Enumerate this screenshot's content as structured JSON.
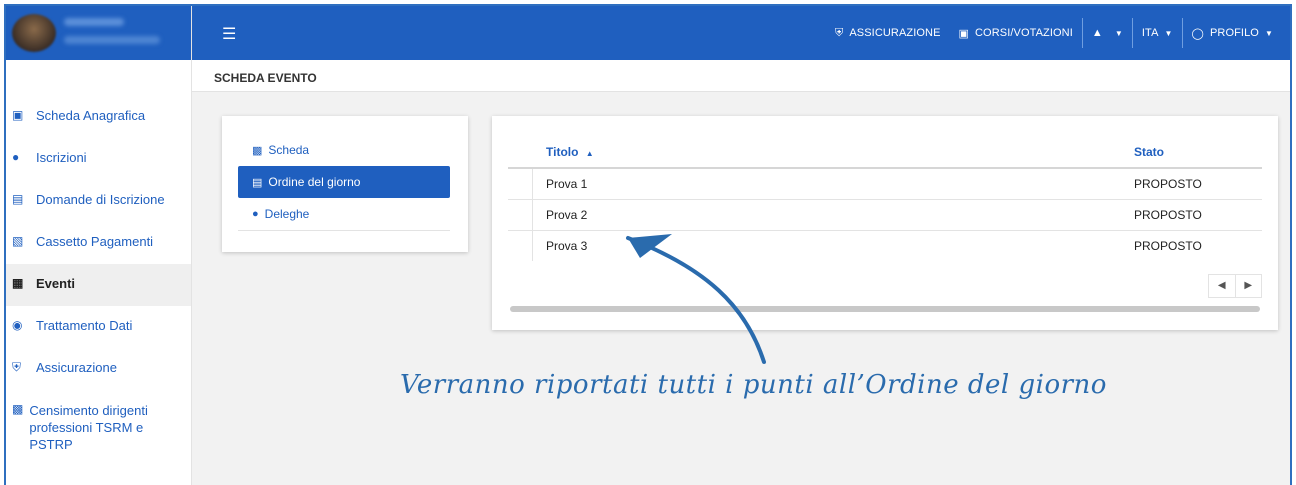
{
  "topbar": {
    "items": [
      {
        "label": "ASSICURAZIONE",
        "icon": "shield-icon"
      },
      {
        "label": "CORSI/VOTAZIONI",
        "icon": "teacher-icon"
      },
      {
        "label": "",
        "icon": "bell-icon"
      },
      {
        "label": "ITA",
        "icon": ""
      },
      {
        "label": "PROFILO",
        "icon": "user-circle-icon"
      }
    ]
  },
  "breadcrumb": "SCHEDA EVENTO",
  "sidebar": {
    "items": [
      {
        "label": "Scheda Anagrafica",
        "icon": "id-card-icon"
      },
      {
        "label": "Iscrizioni",
        "icon": "user-icon"
      },
      {
        "label": "Domande di Iscrizione",
        "icon": "form-icon"
      },
      {
        "label": "Cassetto Pagamenti",
        "icon": "receipt-icon"
      },
      {
        "label": "Eventi",
        "icon": "calendar-icon"
      },
      {
        "label": "Trattamento Dati",
        "icon": "eye-icon"
      },
      {
        "label": "Assicurazione",
        "icon": "shield-icon"
      },
      {
        "label": "Censimento dirigenti professioni TSRM e PSTRP",
        "icon": "clipboard-icon"
      }
    ]
  },
  "event_tabs": [
    {
      "label": "Scheda",
      "icon": "clipboard-icon"
    },
    {
      "label": "Ordine del giorno",
      "icon": "list-icon"
    },
    {
      "label": "Deleghe",
      "icon": "users-icon"
    }
  ],
  "table": {
    "columns": {
      "titolo": "Titolo",
      "stato": "Stato"
    },
    "rows": [
      {
        "titolo": "Prova 1",
        "stato": "PROPOSTO"
      },
      {
        "titolo": "Prova 2",
        "stato": "PROPOSTO"
      },
      {
        "titolo": "Prova 3",
        "stato": "PROPOSTO"
      }
    ]
  },
  "annotation": "Verranno riportati tutti i punti all’Ordine del giorno",
  "colors": {
    "primary": "#1f5fbf",
    "annotation": "#2a6bad"
  }
}
